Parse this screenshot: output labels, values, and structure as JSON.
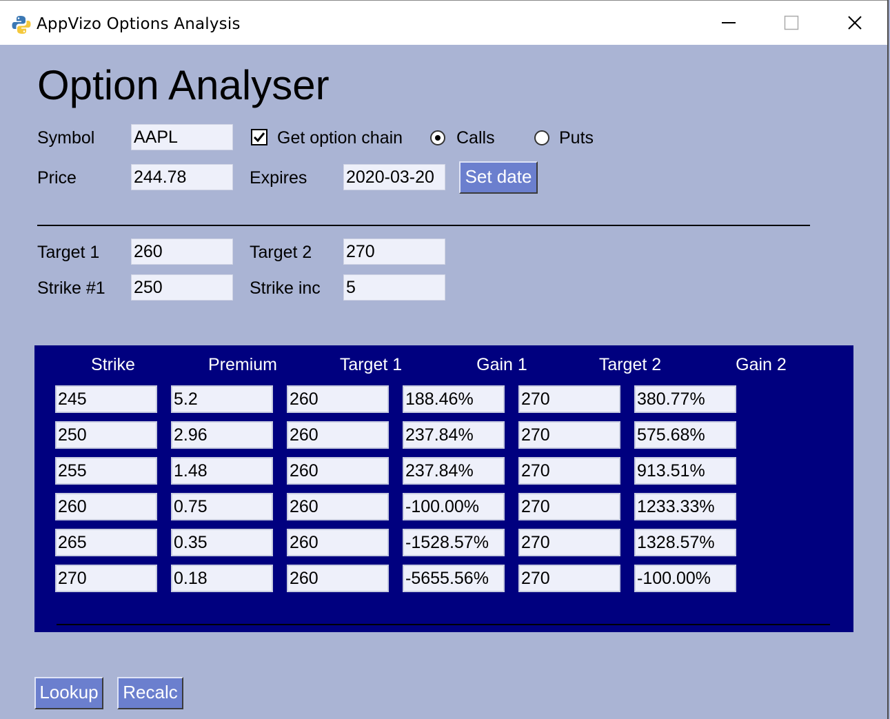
{
  "window": {
    "title": "AppVizo Options Analysis",
    "icon": "python-logo-icon",
    "controls": {
      "minimize": "minimize-icon",
      "maximize": "maximize-icon",
      "close": "close-icon"
    }
  },
  "heading": "Option Analyser",
  "form": {
    "symbol_label": "Symbol",
    "symbol_value": "AAPL",
    "get_chain_label": "Get option chain",
    "get_chain_checked": true,
    "calls_label": "Calls",
    "puts_label": "Puts",
    "selected_type": "Calls",
    "price_label": "Price",
    "price_value": "244.78",
    "expires_label": "Expires",
    "expires_value": "2020-03-20",
    "set_date_label": "Set date",
    "target1_label": "Target 1",
    "target1_value": "260",
    "target2_label": "Target 2",
    "target2_value": "270",
    "strike1_label": "Strike #1",
    "strike1_value": "250",
    "strike_inc_label": "Strike inc",
    "strike_inc_value": "5"
  },
  "table": {
    "headers": [
      "Strike",
      "Premium",
      "Target 1",
      "Gain 1",
      "Target 2",
      "Gain 2"
    ],
    "rows": [
      [
        "245",
        "5.2",
        "260",
        "188.46%",
        "270",
        "380.77%"
      ],
      [
        "250",
        "2.96",
        "260",
        "237.84%",
        "270",
        "575.68%"
      ],
      [
        "255",
        "1.48",
        "260",
        "237.84%",
        "270",
        "913.51%"
      ],
      [
        "260",
        "0.75",
        "260",
        "-100.00%",
        "270",
        "1233.33%"
      ],
      [
        "265",
        "0.35",
        "260",
        "-1528.57%",
        "270",
        "1328.57%"
      ],
      [
        "270",
        "0.18",
        "260",
        "-5655.56%",
        "270",
        "-100.00%"
      ]
    ]
  },
  "buttons": {
    "lookup": "Lookup",
    "recalc": "Recalc"
  },
  "colors": {
    "background": "#aab4d4",
    "panel": "#00007f",
    "button": "#6b7fce",
    "field": "#eef0fa"
  }
}
